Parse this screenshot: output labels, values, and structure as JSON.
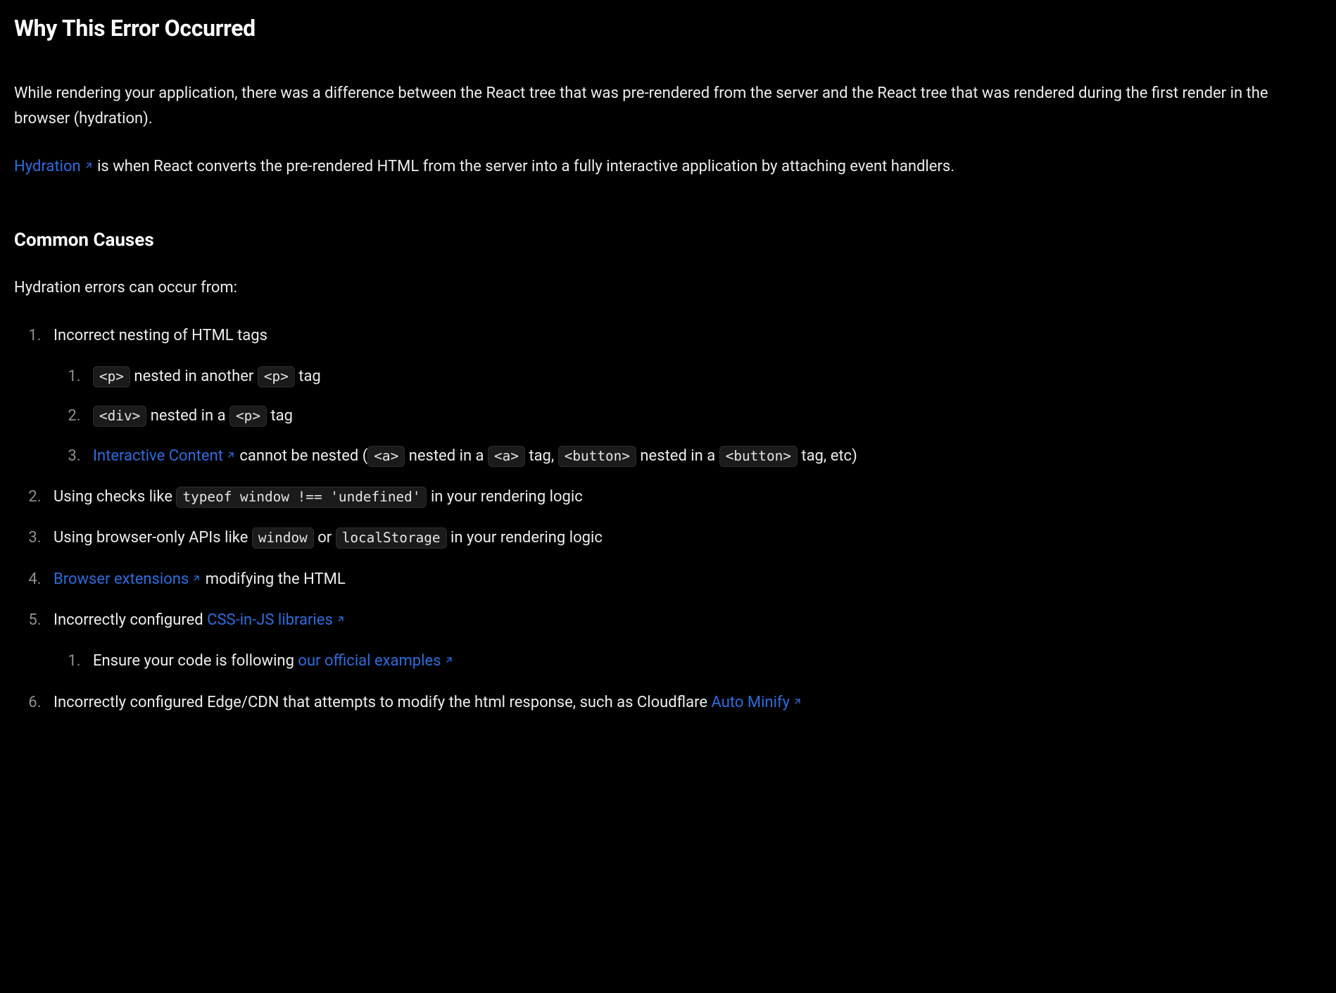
{
  "heading": "Why This Error Occurred",
  "intro_p1": "While rendering your application, there was a difference between the React tree that was pre-rendered from the server and the React tree that was rendered during the first render in the browser (hydration).",
  "intro_p2_link": "Hydration",
  "intro_p2_rest": " is when React converts the pre-rendered HTML from the server into a fully interactive application by attaching event handlers.",
  "causes_heading": "Common Causes",
  "causes_lead": "Hydration errors can occur from:",
  "item1": {
    "text": "Incorrect nesting of HTML tags",
    "sub1": {
      "code1": "<p>",
      "mid": " nested in another ",
      "code2": "<p>",
      "tail": " tag"
    },
    "sub2": {
      "code1": "<div>",
      "mid": " nested in a ",
      "code2": "<p>",
      "tail": " tag"
    },
    "sub3": {
      "link": "Interactive Content",
      "a": " cannot be nested (",
      "c1": "<a>",
      "b": " nested in a ",
      "c2": "<a>",
      "c": " tag, ",
      "c3": "<button>",
      "d": " nested in a ",
      "c4": "<button>",
      "e": " tag, etc)"
    }
  },
  "item2": {
    "pre": "Using checks like ",
    "code": "typeof window !== 'undefined'",
    "post": " in your rendering logic"
  },
  "item3": {
    "pre": "Using browser-only APIs like ",
    "c1": "window",
    "mid": " or ",
    "c2": "localStorage",
    "post": " in your rendering logic"
  },
  "item4": {
    "link": "Browser extensions",
    "post": " modifying the HTML"
  },
  "item5": {
    "pre": "Incorrectly configured ",
    "link": "CSS-in-JS libraries",
    "sub1_pre": "Ensure your code is following ",
    "sub1_link": "our official examples"
  },
  "item6": {
    "pre": "Incorrectly configured Edge/CDN that attempts to modify the html response, such as Cloudflare ",
    "link": "Auto Minify"
  }
}
